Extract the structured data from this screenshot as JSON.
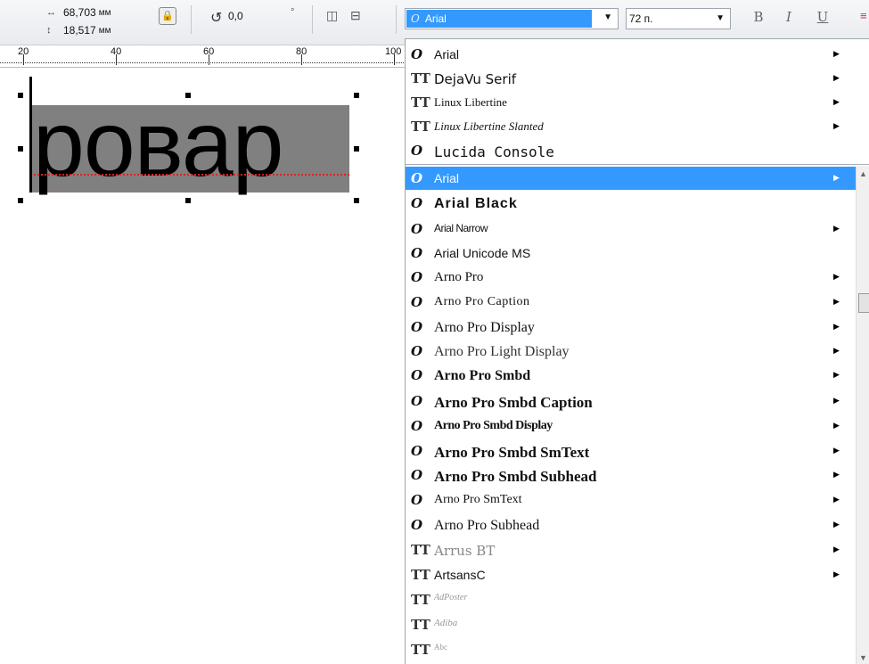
{
  "toolbar": {
    "width_value": "68,703",
    "height_value": "18,517",
    "unit": "мм",
    "rotation_value": "0,0",
    "rotation_unit": "°",
    "font_name": "Arial",
    "font_size": "72 п.",
    "bold_label": "B",
    "italic_label": "I",
    "underline_label": "U"
  },
  "ruler": {
    "labels": [
      "20",
      "40",
      "60",
      "80",
      "100"
    ]
  },
  "canvas": {
    "text": "ровар"
  },
  "fontlist": {
    "recent": [
      {
        "name": "Arial",
        "icon": "O",
        "submenu": true
      },
      {
        "name": "DejaVu Serif",
        "icon": "TT",
        "submenu": true
      },
      {
        "name": "Linux Libertine",
        "icon": "TT",
        "submenu": true
      },
      {
        "name": "Linux Libertine Slanted",
        "icon": "TT",
        "submenu": true
      },
      {
        "name": "Lucida Console",
        "icon": "O",
        "submenu": false
      }
    ],
    "all": [
      {
        "name": "Arial",
        "icon": "O",
        "submenu": true,
        "selected": true
      },
      {
        "name": "Arial Black",
        "icon": "O",
        "submenu": false
      },
      {
        "name": "Arial Narrow",
        "icon": "O",
        "submenu": true
      },
      {
        "name": "Arial Unicode MS",
        "icon": "O",
        "submenu": false
      },
      {
        "name": "Arno Pro",
        "icon": "O",
        "submenu": true
      },
      {
        "name": "Arno Pro Caption",
        "icon": "O",
        "submenu": true
      },
      {
        "name": "Arno Pro Display",
        "icon": "O",
        "submenu": true
      },
      {
        "name": "Arno Pro Light Display",
        "icon": "O",
        "submenu": true
      },
      {
        "name": "Arno Pro Smbd",
        "icon": "O",
        "submenu": true
      },
      {
        "name": "Arno Pro Smbd Caption",
        "icon": "O",
        "submenu": true
      },
      {
        "name": "Arno Pro Smbd Display",
        "icon": "O",
        "submenu": true
      },
      {
        "name": "Arno Pro Smbd SmText",
        "icon": "O",
        "submenu": true
      },
      {
        "name": "Arno Pro Smbd Subhead",
        "icon": "O",
        "submenu": true
      },
      {
        "name": "Arno Pro SmText",
        "icon": "O",
        "submenu": true
      },
      {
        "name": "Arno Pro Subhead",
        "icon": "O",
        "submenu": true
      },
      {
        "name": "Arrus BT",
        "icon": "TT",
        "submenu": true
      },
      {
        "name": "ArtsansC",
        "icon": "TT",
        "submenu": true
      },
      {
        "name": "AdPoster",
        "icon": "TT",
        "submenu": false
      },
      {
        "name": "Adiba",
        "icon": "TT",
        "submenu": false
      },
      {
        "name": "Abc",
        "icon": "TT",
        "submenu": false
      }
    ]
  }
}
